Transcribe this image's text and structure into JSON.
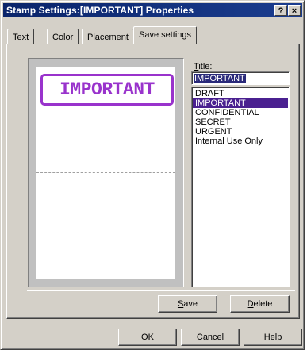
{
  "window": {
    "title": "Stamp Settings:[IMPORTANT] Properties",
    "help_button": "?",
    "close_button": "×"
  },
  "tabs": [
    {
      "label": "Text",
      "active": false
    },
    {
      "label": "Color",
      "active": false
    },
    {
      "label": "Placement",
      "active": false
    },
    {
      "label": "Save settings",
      "active": true
    }
  ],
  "preview": {
    "stamp_text": "IMPORTANT",
    "stamp_color": "#9933cc"
  },
  "title_field": {
    "label_mnemonic": "T",
    "label_rest": "itle:",
    "value": "IMPORTANT"
  },
  "stamp_list": {
    "items": [
      "DRAFT",
      "IMPORTANT",
      "CONFIDENTIAL",
      "SECRET",
      "URGENT",
      "Internal Use Only"
    ],
    "selected": "IMPORTANT"
  },
  "actions": {
    "save_mnemonic": "S",
    "save_rest": "ave",
    "delete_mnemonic": "D",
    "delete_rest": "elete"
  },
  "footer": {
    "ok": "OK",
    "cancel": "Cancel",
    "help": "Help"
  }
}
